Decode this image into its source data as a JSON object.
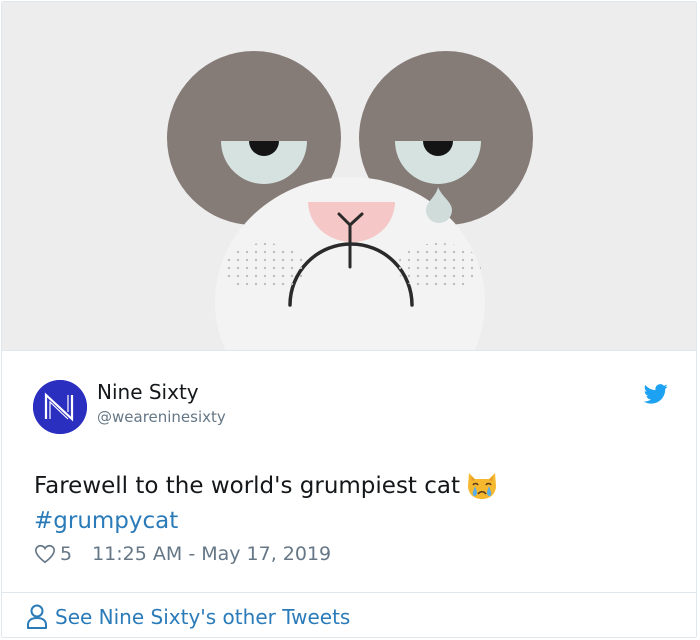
{
  "tweet": {
    "author": {
      "display_name": "Nine Sixty",
      "handle": "@weareninesixty",
      "avatar_letter": "N"
    },
    "text": "Farewell to the world's grumpiest cat",
    "emoji": "crying-cat-emoji",
    "hashtag": "#grumpycat",
    "likes": "5",
    "timestamp": "11:25 AM - May 17, 2019",
    "footer_link": "See Nine Sixty's other Tweets"
  },
  "colors": {
    "link": "#2b7bb9",
    "twitter_blue": "#1da1f2",
    "avatar_bg": "#2b2fbf",
    "media_bg": "#ededed",
    "muted_text": "#657786"
  },
  "icons": {
    "brand": "twitter-bird-icon",
    "like": "heart-icon",
    "profile": "person-icon"
  }
}
